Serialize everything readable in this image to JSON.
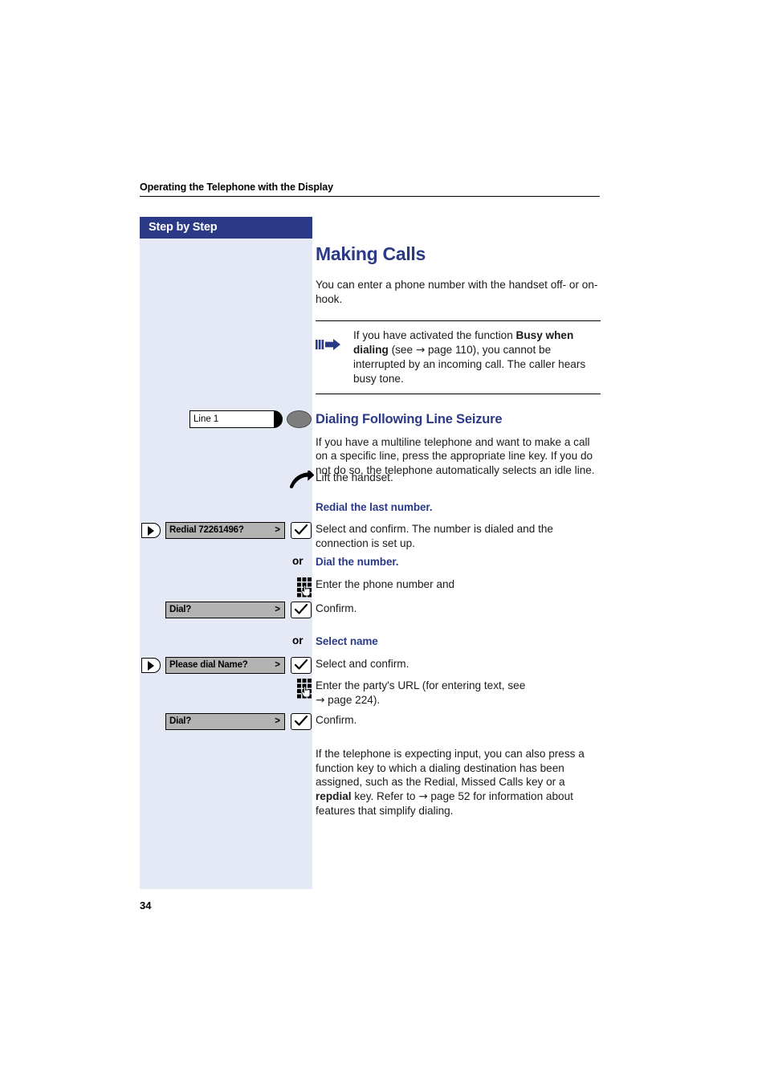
{
  "header": {
    "running_head": "Operating the Telephone with the Display"
  },
  "sidebar": {
    "title": "Step by Step",
    "background_color": "#e4e9f5",
    "title_bar_color": "#2b3a87"
  },
  "page": {
    "number": "34",
    "accent_color": "#2b3a87"
  },
  "content": {
    "section_title": "Making Calls",
    "intro": "You can enter a phone number with the handset off- or on-hook.",
    "note": {
      "icon": "arrow-bullet-icon",
      "text_part1": "If you have activated the function ",
      "bold1": "Busy when dialing",
      "text_part2": " (see ",
      "arrow": "→",
      "page_ref": " page 110), you cannot be interrupted by an incoming call. The caller hears busy tone."
    },
    "subsection_title": "Dialing Following Line Seizure",
    "line_seizure_paragraph": "If you have a multiline telephone and want to make a call on a specific line, press the appropriate line key. If you do not do so, the telephone automatically selects an idle line.",
    "line_key": {
      "label": "Line 1",
      "led_state": "grey"
    },
    "lift_handset": {
      "icon": "handset-off-hook-icon",
      "text": "Lift the handset."
    },
    "steps": [
      {
        "heading": "Redial the last number.",
        "left_icon": "rocker-key-icon",
        "display_key": "Redial 72261496?",
        "chevron": ">",
        "confirm_icon": "checkmark-key-icon",
        "text": "Select and confirm. The number is dialed and the connection is set up."
      },
      {
        "or_label": "or",
        "heading": "Dial the number.",
        "left_icon": "keypad-icon",
        "text": "Enter the phone number and"
      },
      {
        "display_key": "Dial?",
        "chevron": ">",
        "confirm_icon": "checkmark-key-icon",
        "text": "Confirm."
      },
      {
        "or_label": "or",
        "heading": "Select name",
        "left_icon": "rocker-key-icon",
        "display_key": "Please dial Name?",
        "chevron": ">",
        "confirm_icon": "checkmark-key-icon",
        "text": "Select and confirm."
      },
      {
        "left_icon": "keypad-icon",
        "text_part1": "Enter the party's URL (for entering text, see",
        "arrow": "→",
        "text_part2": " page 224)."
      },
      {
        "display_key": "Dial?",
        "chevron": ">",
        "confirm_icon": "checkmark-key-icon",
        "text": "Confirm."
      }
    ],
    "closing_paragraph": {
      "part1": "If the telephone is expecting input, you can also press a function key to which a dialing destination has been assigned, such as the Redial, Missed Calls key or a ",
      "bold1": "repdial",
      "part2": " key. Refer to ",
      "arrow": "→",
      "part3": " page 52 for information about features that simplify dialing."
    }
  }
}
